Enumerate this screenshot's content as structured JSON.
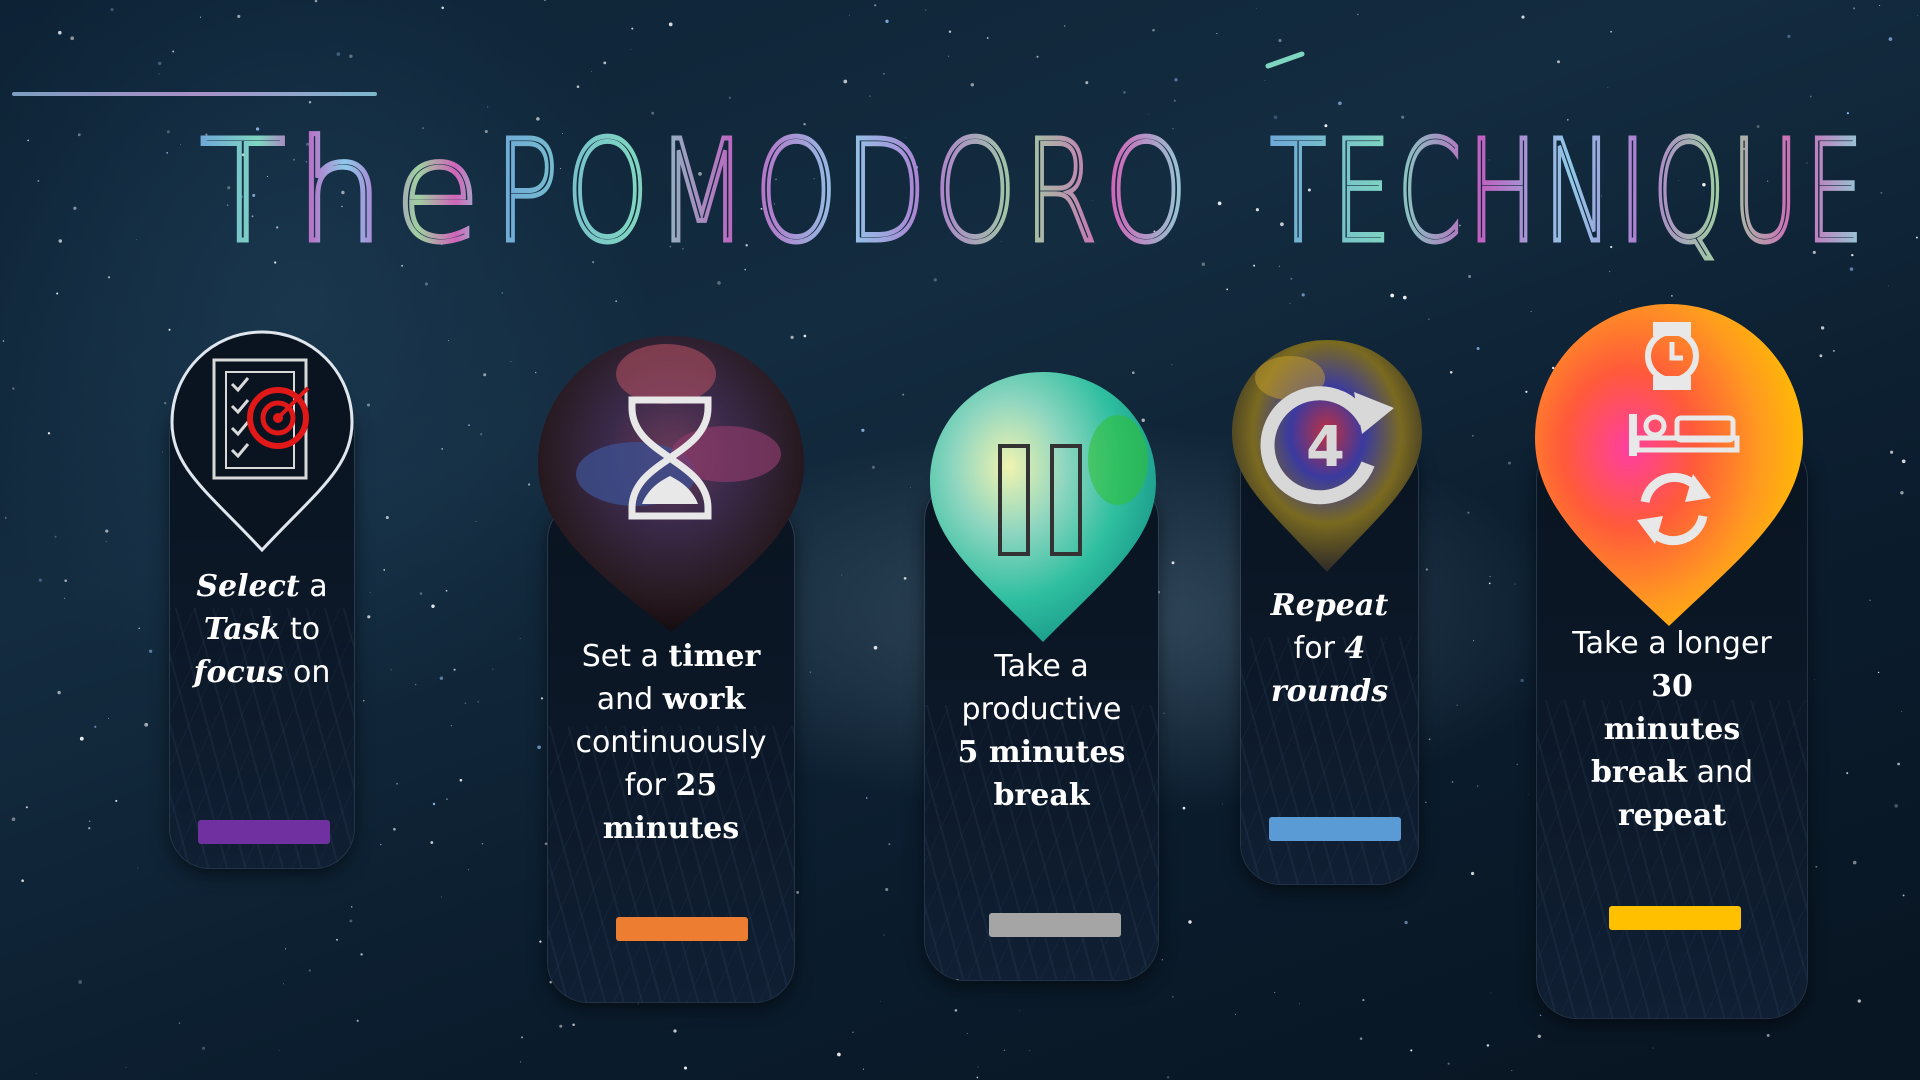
{
  "title": {
    "word1": "The",
    "word2": "POMODORO",
    "word3": "TECHNIQUE"
  },
  "steps": [
    {
      "t1": "Select",
      "t2": " a",
      "t3": "Task",
      "t4": " to",
      "t5": "focus",
      "t6": " on",
      "bar_color": "#7030a0",
      "icon": "checklist-target-icon"
    },
    {
      "t1": "Set a ",
      "t2": "timer",
      "t3": "and ",
      "t4": "work",
      "t5": "continuously",
      "t6": "for ",
      "t7": "25",
      "t8": "minutes",
      "bar_color": "#ed7d31",
      "icon": "hourglass-icon"
    },
    {
      "t1": "Take a",
      "t2": "productive",
      "t3": "5 minutes",
      "t4": "break",
      "bar_color": "#a5a5a5",
      "icon": "pause-icon"
    },
    {
      "t1": "Repeat",
      "t2": "for ",
      "t3": "4",
      "t4": "rounds",
      "bar_color": "#5b9bd5",
      "icon": "repeat-4-icon"
    },
    {
      "t1": "Take a longer",
      "t2": "30",
      "t3": "minutes",
      "t4": "break",
      "t5": " and",
      "t6": "repeat",
      "bar_color": "#ffc000",
      "icon": "watch-bed-cycle-icon"
    }
  ]
}
